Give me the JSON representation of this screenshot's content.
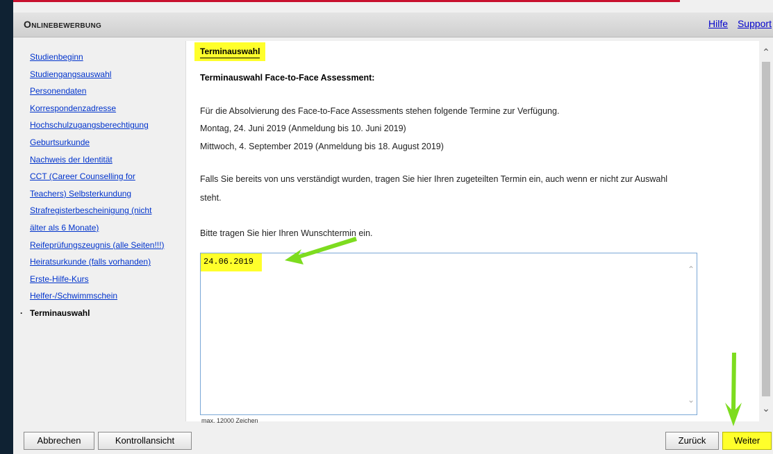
{
  "header": {
    "title": "Onlinebewerbung",
    "help": "Hilfe",
    "support": "Support"
  },
  "sidebar": {
    "items": [
      "Studienbeginn",
      "Studiengangsauswahl",
      "Personendaten",
      "Korrespondenzadresse",
      "Hochschulzugangsberechtigung",
      "Geburtsurkunde",
      "Nachweis der Identität",
      "CCT (Career Counselling for",
      "Teachers) Selbsterkundung",
      "Strafregisterbescheinigung (nicht",
      "älter als 6 Monate)",
      "Reifeprüfungszeugnis (alle Seiten!!!)",
      "Heiratsurkunde (falls vorhanden)",
      "Erste-Hilfe-Kurs",
      "Helfer-/Schwimmschein"
    ],
    "active": "Terminauswahl"
  },
  "content": {
    "section_title": "Terminauswahl",
    "heading": "Terminauswahl Face-to-Face Assessment:",
    "intro": "Für die Absolvierung des Face-to-Face Assessments stehen folgende Termine zur Verfügung.",
    "date1": "Montag, 24. Juni 2019 (Anmeldung bis 10. Juni 2019)",
    "date2": "Mittwoch, 4. September 2019 (Anmeldung bis 18. August 2019)",
    "note_line1": "Falls Sie bereits von uns verständigt wurden, tragen Sie hier Ihren zugeteilten Termin ein, auch wenn er nicht zur Auswahl",
    "note_line2": "steht.",
    "prompt": "Bitte tragen Sie hier Ihren Wunschtermin ein.",
    "input_value": "24.06.2019",
    "limit": "max. 12000 Zeichen"
  },
  "footer": {
    "cancel": "Abbrechen",
    "preview": "Kontrollansicht",
    "back": "Zurück",
    "next": "Weiter"
  },
  "colors": {
    "highlight": "#ffff2b",
    "arrow": "#7ddc1f",
    "link": "#0033cc"
  }
}
